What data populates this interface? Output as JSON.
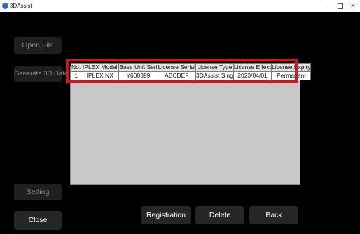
{
  "window": {
    "title": "3DAssist",
    "controls": {
      "minimize": "–",
      "close": "✕"
    }
  },
  "sidebar": {
    "open_file": "Open File",
    "generate_3d": "Generate 3D Data",
    "setting": "Setting",
    "close": "Close"
  },
  "actions": {
    "registration": "Registration",
    "delete": "Delete",
    "back": "Back"
  },
  "license_table": {
    "columns": [
      "No.",
      "IPLEX Model",
      "Base Unit Seri",
      "License Serial",
      "License Type",
      "License Effect",
      "License Expiry"
    ],
    "rows": [
      [
        "1",
        "IPLEX NX",
        "Y600399",
        "ABCDEF",
        "3DAssist Sing",
        "2023/04/01",
        "Permanent"
      ]
    ]
  },
  "colors": {
    "background": "#000000",
    "button": "#262626",
    "highlight": "#d0151c",
    "table_area": "#c8c8c8"
  }
}
